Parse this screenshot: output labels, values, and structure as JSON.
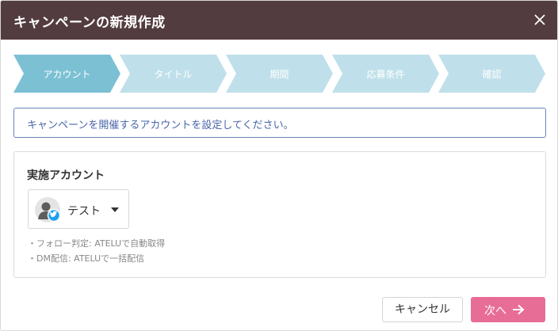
{
  "dialog": {
    "title": "キャンペーンの新規作成"
  },
  "steps": [
    {
      "label": "アカウント",
      "active": true
    },
    {
      "label": "タイトル",
      "active": false
    },
    {
      "label": "期間",
      "active": false
    },
    {
      "label": "応募条件",
      "active": false
    },
    {
      "label": "確認",
      "active": false
    }
  ],
  "notice": {
    "text": "キャンペーンを開催するアカウントを設定してください。"
  },
  "account_section": {
    "title": "実施アカウント",
    "selected_account": "テスト",
    "notes": [
      "・フォロー判定: ATELUで自動取得",
      "・DM配信: ATELUで一括配信"
    ]
  },
  "footer": {
    "cancel_label": "キャンセル",
    "next_label": "次へ"
  },
  "colors": {
    "header_bg": "#533c3f",
    "step_active": "#7cc0d4",
    "step_inactive": "#bfe0ea",
    "notice_border": "#6b83b8",
    "next_button": "#e86d96"
  }
}
